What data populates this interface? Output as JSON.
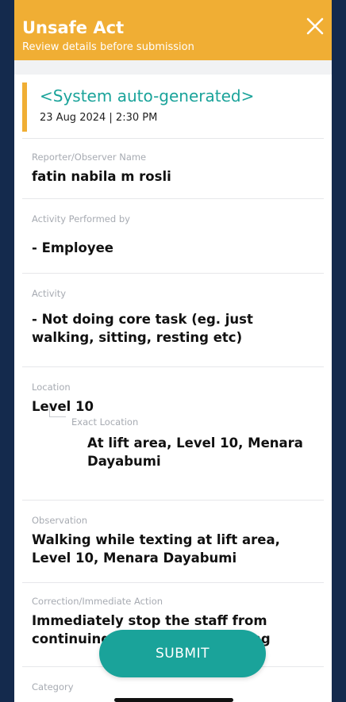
{
  "header": {
    "title": "Unsafe Act",
    "subtitle": "Review details before submission",
    "close_icon": "close-icon",
    "background_color": "#f0ae34"
  },
  "report": {
    "reference": "<System auto-generated>",
    "datetime": "23 Aug 2024 | 2:30 PM",
    "accent_color": "#f0ae34",
    "reference_color": "#1aa39a"
  },
  "fields": {
    "reporter": {
      "label": "Reporter/Observer Name",
      "value": "fatin nabila m rosli"
    },
    "performed_by": {
      "label": "Activity Performed by",
      "value": "- Employee"
    },
    "activity": {
      "label": "Activity",
      "value": "- Not doing core task (eg. just walking, sitting, resting etc)"
    },
    "location": {
      "label": "Location",
      "value": "Level 10",
      "exact_label": "Exact Location",
      "exact_value": "At lift area, Level 10, Menara Dayabumi"
    },
    "observation": {
      "label": "Observation",
      "value": "Walking while texting at lift area, Level 10, Menara Dayabumi"
    },
    "correction": {
      "label": "Correction/Immediate Action",
      "value": "Immediately stop the staff from continuing to text while walking"
    },
    "category": {
      "label": "Category"
    }
  },
  "actions": {
    "submit_label": "SUBMIT",
    "submit_color": "#1aa39a"
  }
}
